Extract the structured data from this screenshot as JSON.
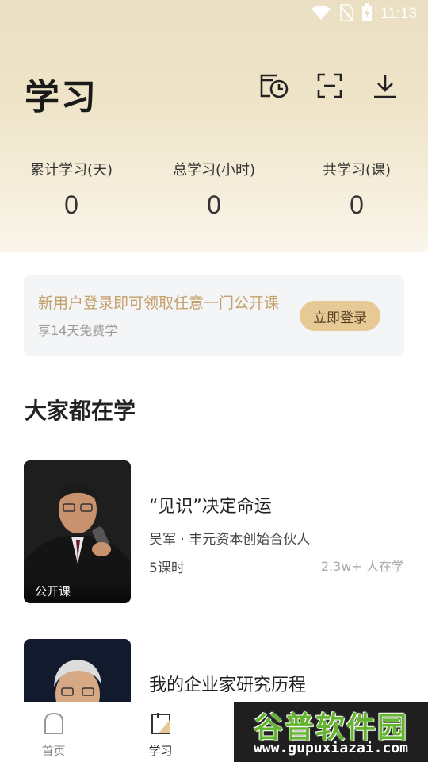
{
  "status_bar": {
    "time": "11:13"
  },
  "header": {
    "title": "学习"
  },
  "stats": [
    {
      "label": "累计学习(天)",
      "value": "0"
    },
    {
      "label": "总学习(小时)",
      "value": "0"
    },
    {
      "label": "共学习(课)",
      "value": "0"
    }
  ],
  "login_banner": {
    "title": "新用户登录即可领取任意一门公开课",
    "subtitle": "享14天免费学",
    "button": "立即登录"
  },
  "section": {
    "title": "大家都在学"
  },
  "courses": [
    {
      "tag": "公开课",
      "name": "“见识”决定命运",
      "author": "吴军 · 丰元资本创始合伙人",
      "lessons": "5课时",
      "learners": "2.3w+ 人在学"
    },
    {
      "tag": "",
      "name": "我的企业家研究历程",
      "author": "",
      "lessons": "",
      "learners": ""
    }
  ],
  "bottom_nav": [
    {
      "label": "首页",
      "icon": "home-icon"
    },
    {
      "label": "学习",
      "icon": "study-icon"
    }
  ],
  "watermark": {
    "main": "谷普软件园",
    "url": "www.gupuxiazai.com"
  },
  "colors": {
    "accent": "#e6c995",
    "accent_text": "#c4a06a",
    "header_bg": "#efe4c8"
  }
}
